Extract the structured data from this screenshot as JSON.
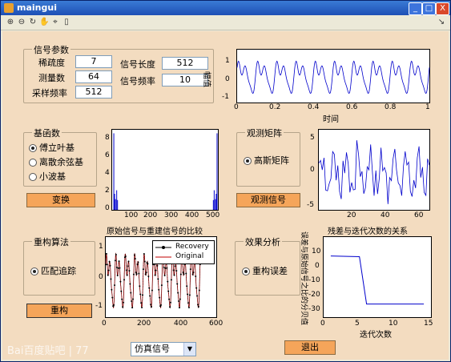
{
  "window": {
    "title": "maingui",
    "min": "_",
    "max": "□",
    "close": "X"
  },
  "toolbar": {
    "corner_arrow": "↘"
  },
  "signal_panel": {
    "title": "信号参数",
    "sparsity_label": "稀疏度",
    "sparsity_value": "7",
    "measure_label": "测量数",
    "measure_value": "64",
    "sample_label": "采样频率",
    "sample_value": "512",
    "length_label": "信号长度",
    "length_value": "512",
    "freq_label": "信号频率",
    "freq_value": "10"
  },
  "basis_panel": {
    "title": "基函数",
    "options": [
      "傅立叶基",
      "离散余弦基",
      "小波基"
    ],
    "selected": 0
  },
  "measure_panel": {
    "title": "观测矩阵",
    "option": "高斯矩阵"
  },
  "recon_panel": {
    "title": "重构算法",
    "option": "匹配追踪"
  },
  "effect_panel": {
    "title": "效果分析",
    "option": "重构误差"
  },
  "buttons": {
    "transform": "变换",
    "observe": "观测信号",
    "reconstruct": "重构",
    "exit": "退出"
  },
  "dropdown": {
    "value": "仿真信号"
  },
  "watermark": "Bai百度贴吧 | 77",
  "chart_data": [
    {
      "type": "line",
      "ylabel": "幅值",
      "xlabel": "时间",
      "x_ticks": [
        "0",
        "0.2",
        "0.4",
        "0.6",
        "0.8",
        "1"
      ],
      "y_ticks": [
        "1",
        "0",
        "-1"
      ],
      "xlim": [
        0,
        1
      ],
      "ylim": [
        -1.3,
        1.3
      ]
    },
    {
      "type": "bar",
      "x_ticks": [
        "100",
        "200",
        "300",
        "400",
        "500"
      ],
      "y_ticks": [
        "8",
        "6",
        "4",
        "2",
        "0"
      ],
      "xlim": [
        0,
        512
      ],
      "ylim": [
        0,
        9
      ],
      "spikes": [
        {
          "x": 8,
          "y": 8.6
        },
        {
          "x": 12,
          "y": 1.8
        },
        {
          "x": 16,
          "y": 1.2
        },
        {
          "x": 22,
          "y": 2.2
        },
        {
          "x": 26,
          "y": 1.1
        },
        {
          "x": 490,
          "y": 1.1
        },
        {
          "x": 494,
          "y": 2.2
        },
        {
          "x": 500,
          "y": 1.2
        },
        {
          "x": 504,
          "y": 1.8
        },
        {
          "x": 508,
          "y": 8.6
        }
      ]
    },
    {
      "type": "line",
      "x_ticks": [
        "20",
        "40",
        "60"
      ],
      "y_ticks": [
        "5",
        "0",
        "-5"
      ],
      "xlim": [
        0,
        64
      ],
      "ylim": [
        -5.5,
        6.5
      ]
    },
    {
      "type": "line",
      "title": "原始信号与重建信号的比较",
      "x_ticks": [
        "0",
        "200",
        "400",
        "600"
      ],
      "y_ticks": [
        "1",
        "0",
        "-1"
      ],
      "xlim": [
        0,
        600
      ],
      "ylim": [
        -1.5,
        1.6
      ],
      "series": [
        {
          "name": "Recovery"
        },
        {
          "name": "Original"
        }
      ]
    },
    {
      "type": "line",
      "title": "残差与迭代次数的关系",
      "xlabel": "迭代次数",
      "ylabel": "误差与原始信号之比的分贝值",
      "x_ticks": [
        "0",
        "5",
        "10",
        "15"
      ],
      "y_ticks": [
        "10",
        "0",
        "-10",
        "-20",
        "-30",
        "-40"
      ],
      "xlim": [
        0,
        15
      ],
      "ylim": [
        -40,
        15
      ],
      "x": [
        1,
        5,
        6,
        14
      ],
      "y": [
        2,
        1.5,
        -31,
        -31
      ]
    }
  ]
}
